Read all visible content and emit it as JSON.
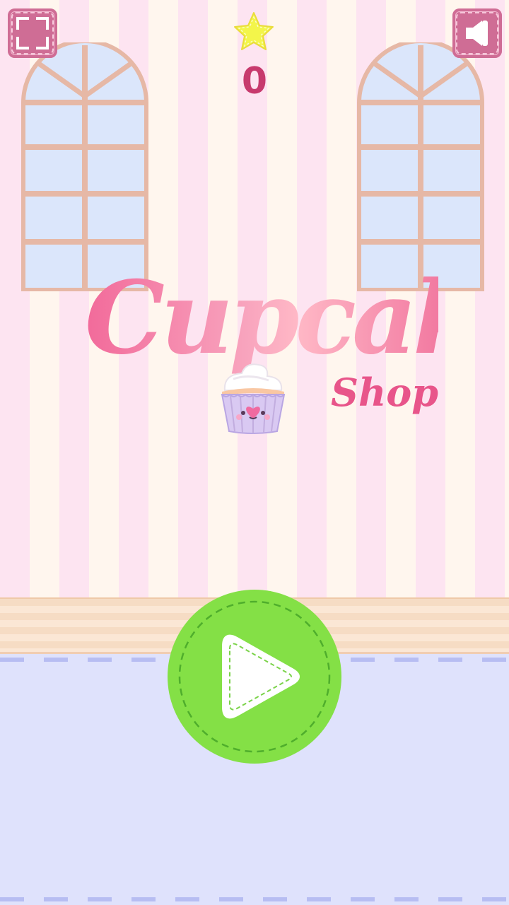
{
  "game": {
    "title": "Cupcake",
    "subtitle": "Shop",
    "score": "0"
  },
  "controls": {
    "fullscreen_icon": "fullscreen-icon",
    "sound_icon": "speaker-icon",
    "play_icon": "play-icon"
  },
  "colors": {
    "wall_stripe_pink": "#fde4f1",
    "wall_stripe_cream": "#fff6ee",
    "button_pink": "#cf6d95",
    "play_green": "#84e046",
    "score_color": "#c73a6d",
    "floor": "#dfe2fc",
    "star": "#f3f54a"
  }
}
